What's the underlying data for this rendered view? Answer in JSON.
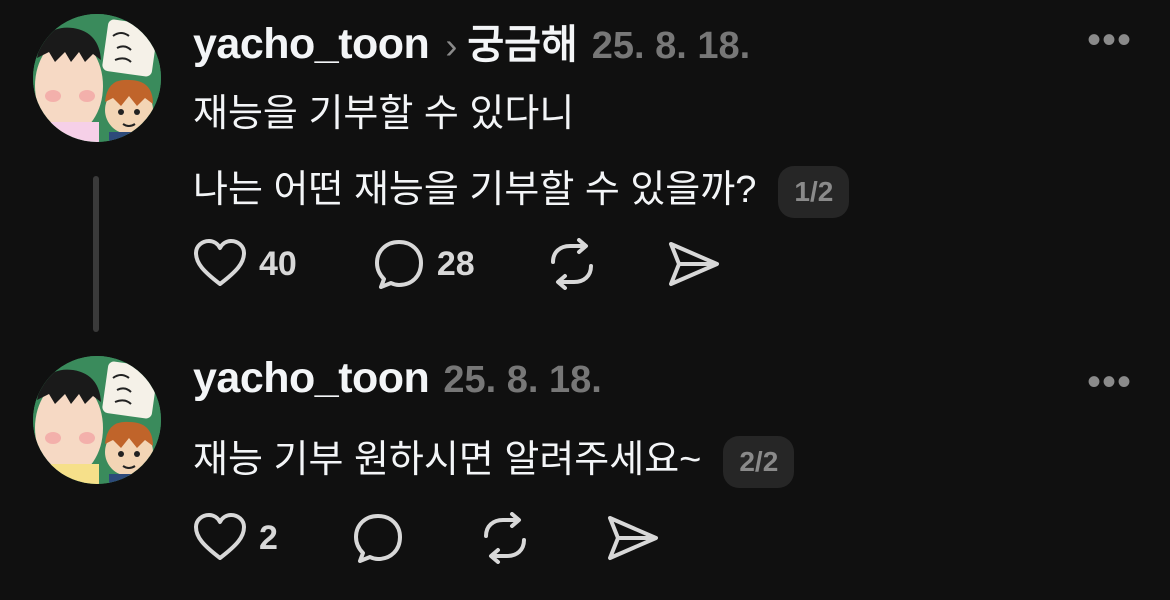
{
  "posts": [
    {
      "username": "yacho_toon",
      "topic": "궁금해",
      "date": "25. 8. 18.",
      "lines": [
        "재능을 기부할 수 있다니",
        "나는 어떤 재능을 기부할 수 있을까?"
      ],
      "page_indicator": "1/2",
      "likes": "40",
      "comments": "28",
      "more_icon": "•••"
    },
    {
      "username": "yacho_toon",
      "date": "25. 8. 18.",
      "lines": [
        "재능 기부 원하시면 알려주세요~"
      ],
      "page_indicator": "2/2",
      "likes": "2",
      "more_icon": "•••"
    }
  ],
  "icons": {
    "like": "heart-icon",
    "comment": "speech-bubble-icon",
    "repost": "repost-icon",
    "share": "send-icon",
    "more": "more-options-icon",
    "topic_separator": "chevron-right-icon"
  },
  "colors": {
    "background": "#101010",
    "text": "#f3f5f7",
    "muted": "#777777",
    "badge": "#262626"
  }
}
